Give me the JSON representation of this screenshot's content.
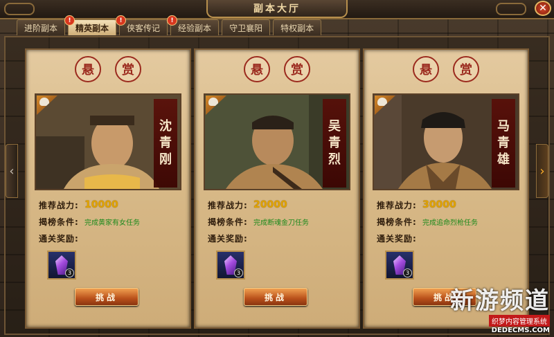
{
  "window": {
    "title": "副本大厅",
    "close_label": "✕"
  },
  "tabs": [
    {
      "label": "进阶副本",
      "badge": false
    },
    {
      "label": "精英副本",
      "badge": true,
      "active": true
    },
    {
      "label": "侠客传记",
      "badge": true
    },
    {
      "label": "经验副本",
      "badge": true
    },
    {
      "label": "守卫襄阳",
      "badge": false
    },
    {
      "label": "特权副本",
      "badge": false
    }
  ],
  "badge_symbol": "!",
  "labels": {
    "power": "推荐战力:",
    "condition": "揭榜条件:",
    "reward": "通关奖励:",
    "challenge": "挑战"
  },
  "cards": [
    {
      "seal_1": "悬",
      "seal_2": "赏",
      "name": [
        "沈",
        "青",
        "刚"
      ],
      "power": "10000",
      "condition": "完成黄家有女任务",
      "reward_count": "3"
    },
    {
      "seal_1": "悬",
      "seal_2": "赏",
      "name": [
        "吴",
        "青",
        "烈"
      ],
      "power": "20000",
      "condition": "完成断魂金刀任务",
      "reward_count": "3"
    },
    {
      "seal_1": "悬",
      "seal_2": "赏",
      "name": [
        "马",
        "青",
        "雄"
      ],
      "power": "30000",
      "condition": "完成追命烈枪任务",
      "reward_count": "3"
    }
  ],
  "nav": {
    "left": "‹",
    "right": "›"
  },
  "watermark": {
    "big": "新游频道",
    "small": "织梦内容管理系统",
    "url": "DEDECMS.COM"
  },
  "colors": {
    "accent": "#e1a300",
    "condition": "#1d8a1d",
    "seal": "#9b2a1e"
  }
}
